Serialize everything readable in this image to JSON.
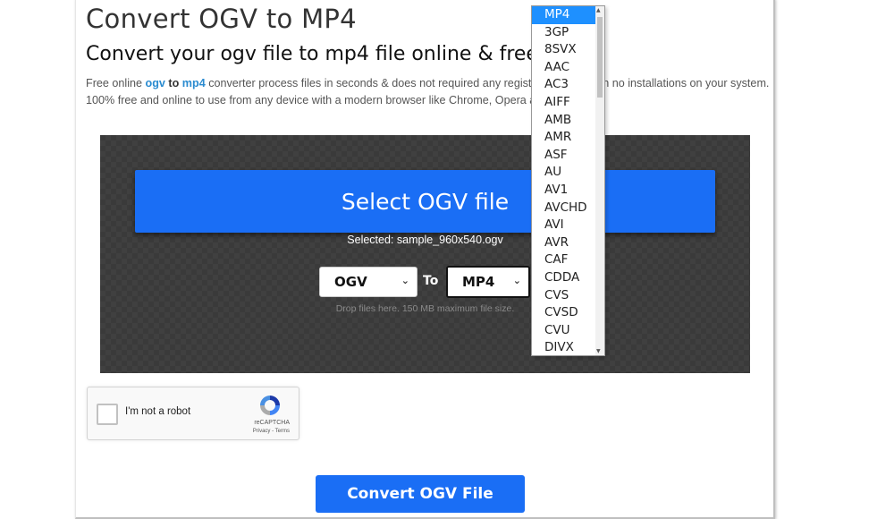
{
  "header": {
    "title": "Convert OGV to MP4",
    "subtitle": "Convert your ogv file to mp4 file online & free",
    "description": {
      "part1": "Free online ",
      "link_from": "ogv",
      "to_word": " to ",
      "link_to": "mp4",
      "part2": " converter process files in seconds & does not required any registration and even no installations on your system. 100% free and online to use from any device with a modern browser like Chrome, Opera and Firefox."
    }
  },
  "uploader": {
    "select_button_label": "Select OGV file",
    "selected_file_text": "Selected: sample_960x540.ogv",
    "from_format": "OGV",
    "to_label": "To",
    "to_format": "MP4",
    "hint": "Drop files here. 150 MB maximum file size."
  },
  "recaptcha": {
    "label": "I'm not a robot",
    "brand": "reCAPTCHA",
    "links": "Privacy - Terms",
    "checked": false
  },
  "convert_button_label": "Convert OGV File",
  "format_dropdown": {
    "selected": "MP4",
    "options": [
      "MP4",
      "3GP",
      "8SVX",
      "AAC",
      "AC3",
      "AIFF",
      "AMB",
      "AMR",
      "ASF",
      "AU",
      "AV1",
      "AVCHD",
      "AVI",
      "AVR",
      "CAF",
      "CDDA",
      "CVS",
      "CVSD",
      "CVU",
      "DIVX"
    ]
  },
  "colors": {
    "accent": "#1a6ef5",
    "link": "#2a8bd0",
    "dropdown_highlight": "#1e90ff",
    "dropzone_bg": "#3a3a3a"
  }
}
